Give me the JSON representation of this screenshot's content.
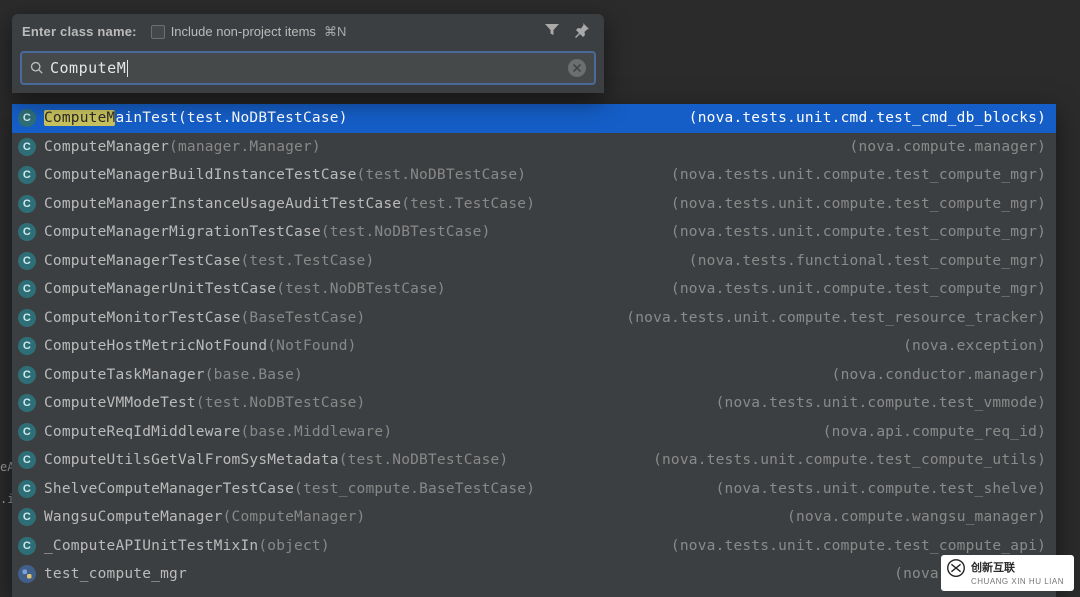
{
  "dialog": {
    "label": "Enter class name:",
    "checkbox_label": "Include non-project items",
    "shortcut": "⌘N"
  },
  "search": {
    "query": "ComputeM",
    "match_prefix": "ComputeM"
  },
  "results": [
    {
      "name": "ComputeMainTest",
      "ctx": "test.NoDBTestCase",
      "location": "nova.tests.unit.cmd.test_cmd_db_blocks",
      "selected": true
    },
    {
      "name": "ComputeManager",
      "ctx": "manager.Manager",
      "location": "nova.compute.manager"
    },
    {
      "name": "ComputeManagerBuildInstanceTestCase",
      "ctx": "test.NoDBTestCase",
      "location": "nova.tests.unit.compute.test_compute_mgr"
    },
    {
      "name": "ComputeManagerInstanceUsageAuditTestCase",
      "ctx": "test.TestCase",
      "location": "nova.tests.unit.compute.test_compute_mgr"
    },
    {
      "name": "ComputeManagerMigrationTestCase",
      "ctx": "test.NoDBTestCase",
      "location": "nova.tests.unit.compute.test_compute_mgr"
    },
    {
      "name": "ComputeManagerTestCase",
      "ctx": "test.TestCase",
      "location": "nova.tests.functional.test_compute_mgr"
    },
    {
      "name": "ComputeManagerUnitTestCase",
      "ctx": "test.NoDBTestCase",
      "location": "nova.tests.unit.compute.test_compute_mgr"
    },
    {
      "name": "ComputeMonitorTestCase",
      "ctx": "BaseTestCase",
      "location": "nova.tests.unit.compute.test_resource_tracker"
    },
    {
      "name": "ComputeHostMetricNotFound",
      "ctx": "NotFound",
      "location": "nova.exception"
    },
    {
      "name": "ComputeTaskManager",
      "ctx": "base.Base",
      "location": "nova.conductor.manager"
    },
    {
      "name": "ComputeVMModeTest",
      "ctx": "test.NoDBTestCase",
      "location": "nova.tests.unit.compute.test_vmmode"
    },
    {
      "name": "ComputeReqIdMiddleware",
      "ctx": "base.Middleware",
      "location": "nova.api.compute_req_id"
    },
    {
      "name": "ComputeUtilsGetValFromSysMetadata",
      "ctx": "test.NoDBTestCase",
      "location": "nova.tests.unit.compute.test_compute_utils"
    },
    {
      "name": "ShelveComputeManagerTestCase",
      "ctx": "test_compute.BaseTestCase",
      "location": "nova.tests.unit.compute.test_shelve"
    },
    {
      "name": "WangsuComputeManager",
      "ctx": "ComputeManager",
      "location": "nova.compute.wangsu_manager"
    },
    {
      "name": "_ComputeAPIUnitTestMixIn",
      "ctx": "object",
      "location": "nova.tests.unit.compute.test_compute_api"
    },
    {
      "name": "test_compute_mgr",
      "ctx": "",
      "location": "nova.tests.func",
      "icon": "py"
    }
  ],
  "watermark": {
    "title": "创新互联",
    "sub": "CHUANG XIN HU LIAN"
  }
}
